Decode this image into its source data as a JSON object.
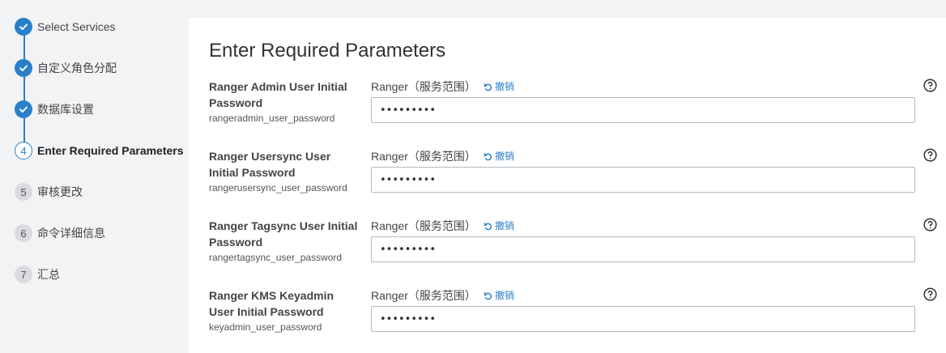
{
  "wizard": {
    "steps": [
      {
        "num": "",
        "label": "Select Services",
        "state": "done"
      },
      {
        "num": "",
        "label": "自定义角色分配",
        "state": "done"
      },
      {
        "num": "",
        "label": "数据库设置",
        "state": "done"
      },
      {
        "num": "4",
        "label": "Enter Required Parameters",
        "state": "current"
      },
      {
        "num": "5",
        "label": "审核更改",
        "state": "todo"
      },
      {
        "num": "6",
        "label": "命令详细信息",
        "state": "todo"
      },
      {
        "num": "7",
        "label": "汇总",
        "state": "todo"
      }
    ]
  },
  "main": {
    "title": "Enter Required Parameters",
    "params": [
      {
        "name": "Ranger Admin User Initial Password",
        "key": "rangeradmin_user_password",
        "scope": "Ranger（服务范围）",
        "undo": "撤销",
        "value": "•••••••••"
      },
      {
        "name": "Ranger Usersync User Initial Password",
        "key": "rangerusersync_user_password",
        "scope": "Ranger（服务范围）",
        "undo": "撤销",
        "value": "•••••••••"
      },
      {
        "name": "Ranger Tagsync User Initial Password",
        "key": "rangertagsync_user_password",
        "scope": "Ranger（服务范围）",
        "undo": "撤销",
        "value": "•••••••••"
      },
      {
        "name": "Ranger KMS Keyadmin User Initial Password",
        "key": "keyadmin_user_password",
        "scope": "Ranger（服务范围）",
        "undo": "撤销",
        "value": "•••••••••"
      }
    ]
  },
  "colors": {
    "accent": "#2a7fc9",
    "sidebar_bg": "#f2f3f5",
    "panel_bg": "#ffffff"
  },
  "icons": {
    "done": "check-icon",
    "undo": "undo-arrow-icon",
    "help": "question-circle-icon"
  }
}
